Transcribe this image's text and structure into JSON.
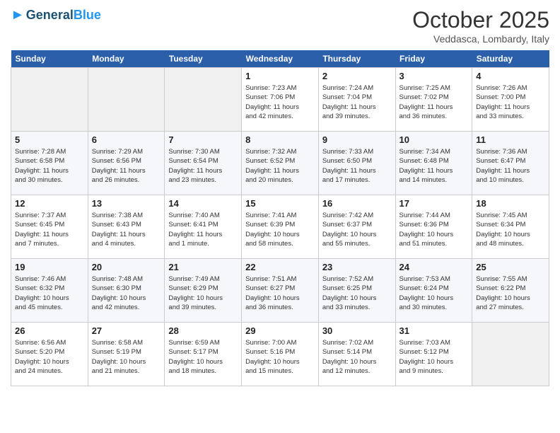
{
  "header": {
    "logo_line1": "General",
    "logo_line2": "Blue",
    "month": "October 2025",
    "location": "Veddasca, Lombardy, Italy"
  },
  "days_of_week": [
    "Sunday",
    "Monday",
    "Tuesday",
    "Wednesday",
    "Thursday",
    "Friday",
    "Saturday"
  ],
  "weeks": [
    [
      {
        "num": "",
        "text": ""
      },
      {
        "num": "",
        "text": ""
      },
      {
        "num": "",
        "text": ""
      },
      {
        "num": "1",
        "text": "Sunrise: 7:23 AM\nSunset: 7:06 PM\nDaylight: 11 hours\nand 42 minutes."
      },
      {
        "num": "2",
        "text": "Sunrise: 7:24 AM\nSunset: 7:04 PM\nDaylight: 11 hours\nand 39 minutes."
      },
      {
        "num": "3",
        "text": "Sunrise: 7:25 AM\nSunset: 7:02 PM\nDaylight: 11 hours\nand 36 minutes."
      },
      {
        "num": "4",
        "text": "Sunrise: 7:26 AM\nSunset: 7:00 PM\nDaylight: 11 hours\nand 33 minutes."
      }
    ],
    [
      {
        "num": "5",
        "text": "Sunrise: 7:28 AM\nSunset: 6:58 PM\nDaylight: 11 hours\nand 30 minutes."
      },
      {
        "num": "6",
        "text": "Sunrise: 7:29 AM\nSunset: 6:56 PM\nDaylight: 11 hours\nand 26 minutes."
      },
      {
        "num": "7",
        "text": "Sunrise: 7:30 AM\nSunset: 6:54 PM\nDaylight: 11 hours\nand 23 minutes."
      },
      {
        "num": "8",
        "text": "Sunrise: 7:32 AM\nSunset: 6:52 PM\nDaylight: 11 hours\nand 20 minutes."
      },
      {
        "num": "9",
        "text": "Sunrise: 7:33 AM\nSunset: 6:50 PM\nDaylight: 11 hours\nand 17 minutes."
      },
      {
        "num": "10",
        "text": "Sunrise: 7:34 AM\nSunset: 6:48 PM\nDaylight: 11 hours\nand 14 minutes."
      },
      {
        "num": "11",
        "text": "Sunrise: 7:36 AM\nSunset: 6:47 PM\nDaylight: 11 hours\nand 10 minutes."
      }
    ],
    [
      {
        "num": "12",
        "text": "Sunrise: 7:37 AM\nSunset: 6:45 PM\nDaylight: 11 hours\nand 7 minutes."
      },
      {
        "num": "13",
        "text": "Sunrise: 7:38 AM\nSunset: 6:43 PM\nDaylight: 11 hours\nand 4 minutes."
      },
      {
        "num": "14",
        "text": "Sunrise: 7:40 AM\nSunset: 6:41 PM\nDaylight: 11 hours\nand 1 minute."
      },
      {
        "num": "15",
        "text": "Sunrise: 7:41 AM\nSunset: 6:39 PM\nDaylight: 10 hours\nand 58 minutes."
      },
      {
        "num": "16",
        "text": "Sunrise: 7:42 AM\nSunset: 6:37 PM\nDaylight: 10 hours\nand 55 minutes."
      },
      {
        "num": "17",
        "text": "Sunrise: 7:44 AM\nSunset: 6:36 PM\nDaylight: 10 hours\nand 51 minutes."
      },
      {
        "num": "18",
        "text": "Sunrise: 7:45 AM\nSunset: 6:34 PM\nDaylight: 10 hours\nand 48 minutes."
      }
    ],
    [
      {
        "num": "19",
        "text": "Sunrise: 7:46 AM\nSunset: 6:32 PM\nDaylight: 10 hours\nand 45 minutes."
      },
      {
        "num": "20",
        "text": "Sunrise: 7:48 AM\nSunset: 6:30 PM\nDaylight: 10 hours\nand 42 minutes."
      },
      {
        "num": "21",
        "text": "Sunrise: 7:49 AM\nSunset: 6:29 PM\nDaylight: 10 hours\nand 39 minutes."
      },
      {
        "num": "22",
        "text": "Sunrise: 7:51 AM\nSunset: 6:27 PM\nDaylight: 10 hours\nand 36 minutes."
      },
      {
        "num": "23",
        "text": "Sunrise: 7:52 AM\nSunset: 6:25 PM\nDaylight: 10 hours\nand 33 minutes."
      },
      {
        "num": "24",
        "text": "Sunrise: 7:53 AM\nSunset: 6:24 PM\nDaylight: 10 hours\nand 30 minutes."
      },
      {
        "num": "25",
        "text": "Sunrise: 7:55 AM\nSunset: 6:22 PM\nDaylight: 10 hours\nand 27 minutes."
      }
    ],
    [
      {
        "num": "26",
        "text": "Sunrise: 6:56 AM\nSunset: 5:20 PM\nDaylight: 10 hours\nand 24 minutes."
      },
      {
        "num": "27",
        "text": "Sunrise: 6:58 AM\nSunset: 5:19 PM\nDaylight: 10 hours\nand 21 minutes."
      },
      {
        "num": "28",
        "text": "Sunrise: 6:59 AM\nSunset: 5:17 PM\nDaylight: 10 hours\nand 18 minutes."
      },
      {
        "num": "29",
        "text": "Sunrise: 7:00 AM\nSunset: 5:16 PM\nDaylight: 10 hours\nand 15 minutes."
      },
      {
        "num": "30",
        "text": "Sunrise: 7:02 AM\nSunset: 5:14 PM\nDaylight: 10 hours\nand 12 minutes."
      },
      {
        "num": "31",
        "text": "Sunrise: 7:03 AM\nSunset: 5:12 PM\nDaylight: 10 hours\nand 9 minutes."
      },
      {
        "num": "",
        "text": ""
      }
    ]
  ]
}
